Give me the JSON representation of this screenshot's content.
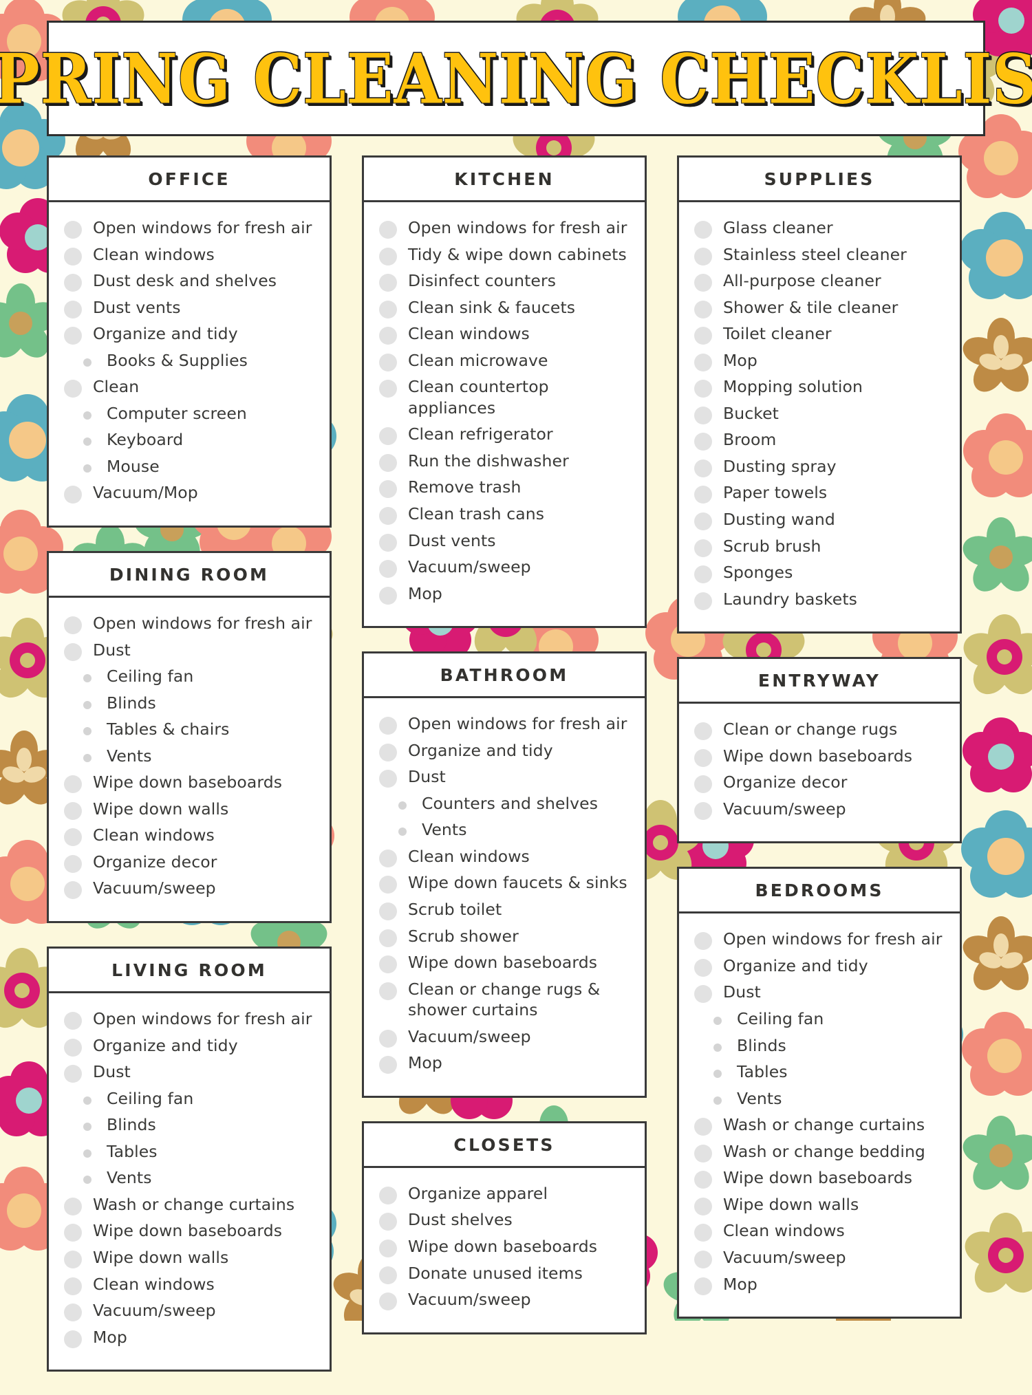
{
  "header": {
    "title": "SPRING CLEANING CHECKLIST"
  },
  "theme": {
    "accent_yellow": "#FFC20E",
    "ink": "#3a3a38",
    "card_bg": "#FFFFFF",
    "page_bg": "#FCF8DC",
    "bullet": "#E2E2E2",
    "sub_bullet": "#D4D4D4",
    "floral_coral": "#F28C7B",
    "floral_teal": "#5BAFC0",
    "floral_peach": "#F5C888",
    "floral_magenta": "#D81B73",
    "floral_green": "#74C189",
    "floral_brown": "#BE8B45",
    "floral_olive": "#CFC273"
  },
  "columns": [
    {
      "cards": [
        {
          "title": "OFFICE",
          "items": [
            {
              "label": "Open windows for fresh air",
              "sub": false
            },
            {
              "label": "Clean windows",
              "sub": false
            },
            {
              "label": "Dust desk and shelves",
              "sub": false
            },
            {
              "label": "Dust vents",
              "sub": false
            },
            {
              "label": "Organize and tidy",
              "sub": false
            },
            {
              "label": "Books & Supplies",
              "sub": true
            },
            {
              "label": "Clean",
              "sub": false
            },
            {
              "label": "Computer screen",
              "sub": true
            },
            {
              "label": "Keyboard",
              "sub": true
            },
            {
              "label": "Mouse",
              "sub": true
            },
            {
              "label": "Vacuum/Mop",
              "sub": false
            }
          ]
        },
        {
          "title": "DINING ROOM",
          "items": [
            {
              "label": "Open windows for fresh air",
              "sub": false
            },
            {
              "label": "Dust",
              "sub": false
            },
            {
              "label": "Ceiling fan",
              "sub": true
            },
            {
              "label": "Blinds",
              "sub": true
            },
            {
              "label": "Tables & chairs",
              "sub": true
            },
            {
              "label": "Vents",
              "sub": true
            },
            {
              "label": "Wipe down baseboards",
              "sub": false
            },
            {
              "label": "Wipe down walls",
              "sub": false
            },
            {
              "label": "Clean windows",
              "sub": false
            },
            {
              "label": "Organize decor",
              "sub": false
            },
            {
              "label": "Vacuum/sweep",
              "sub": false
            }
          ]
        },
        {
          "title": "LIVING ROOM",
          "items": [
            {
              "label": "Open windows for fresh air",
              "sub": false
            },
            {
              "label": "Organize and tidy",
              "sub": false
            },
            {
              "label": "Dust",
              "sub": false
            },
            {
              "label": "Ceiling fan",
              "sub": true
            },
            {
              "label": "Blinds",
              "sub": true
            },
            {
              "label": "Tables",
              "sub": true
            },
            {
              "label": "Vents",
              "sub": true
            },
            {
              "label": "Wash or change curtains",
              "sub": false
            },
            {
              "label": "Wipe down baseboards",
              "sub": false
            },
            {
              "label": "Wipe down walls",
              "sub": false
            },
            {
              "label": "Clean windows",
              "sub": false
            },
            {
              "label": "Vacuum/sweep",
              "sub": false
            },
            {
              "label": "Mop",
              "sub": false
            }
          ]
        }
      ]
    },
    {
      "cards": [
        {
          "title": "KITCHEN",
          "items": [
            {
              "label": "Open windows for fresh air",
              "sub": false
            },
            {
              "label": "Tidy & wipe down cabinets",
              "sub": false
            },
            {
              "label": "Disinfect counters",
              "sub": false
            },
            {
              "label": "Clean sink & faucets",
              "sub": false
            },
            {
              "label": "Clean windows",
              "sub": false
            },
            {
              "label": "Clean microwave",
              "sub": false
            },
            {
              "label": "Clean countertop appliances",
              "sub": false
            },
            {
              "label": "Clean refrigerator",
              "sub": false
            },
            {
              "label": "Run the dishwasher",
              "sub": false
            },
            {
              "label": "Remove trash",
              "sub": false
            },
            {
              "label": "Clean trash cans",
              "sub": false
            },
            {
              "label": "Dust vents",
              "sub": false
            },
            {
              "label": "Vacuum/sweep",
              "sub": false
            },
            {
              "label": "Mop",
              "sub": false
            }
          ]
        },
        {
          "title": "BATHROOM",
          "items": [
            {
              "label": "Open windows for fresh air",
              "sub": false
            },
            {
              "label": "Organize and tidy",
              "sub": false
            },
            {
              "label": "Dust",
              "sub": false
            },
            {
              "label": "Counters and shelves",
              "sub": true
            },
            {
              "label": "Vents",
              "sub": true
            },
            {
              "label": "Clean windows",
              "sub": false
            },
            {
              "label": "Wipe down faucets & sinks",
              "sub": false
            },
            {
              "label": "Scrub toilet",
              "sub": false
            },
            {
              "label": "Scrub shower",
              "sub": false
            },
            {
              "label": "Wipe down baseboards",
              "sub": false
            },
            {
              "label": "Clean or change rugs & shower curtains",
              "sub": false
            },
            {
              "label": "Vacuum/sweep",
              "sub": false
            },
            {
              "label": "Mop",
              "sub": false
            }
          ]
        },
        {
          "title": "CLOSETS",
          "items": [
            {
              "label": "Organize apparel",
              "sub": false
            },
            {
              "label": "Dust shelves",
              "sub": false
            },
            {
              "label": "Wipe down baseboards",
              "sub": false
            },
            {
              "label": "Donate unused items",
              "sub": false
            },
            {
              "label": "Vacuum/sweep",
              "sub": false
            }
          ]
        }
      ]
    },
    {
      "cards": [
        {
          "title": "SUPPLIES",
          "items": [
            {
              "label": "Glass cleaner",
              "sub": false
            },
            {
              "label": "Stainless steel cleaner",
              "sub": false
            },
            {
              "label": "All-purpose cleaner",
              "sub": false
            },
            {
              "label": "Shower & tile cleaner",
              "sub": false
            },
            {
              "label": "Toilet cleaner",
              "sub": false
            },
            {
              "label": "Mop",
              "sub": false
            },
            {
              "label": "Mopping solution",
              "sub": false
            },
            {
              "label": "Bucket",
              "sub": false
            },
            {
              "label": "Broom",
              "sub": false
            },
            {
              "label": "Dusting spray",
              "sub": false
            },
            {
              "label": "Paper towels",
              "sub": false
            },
            {
              "label": "Dusting wand",
              "sub": false
            },
            {
              "label": "Scrub brush",
              "sub": false
            },
            {
              "label": "Sponges",
              "sub": false
            },
            {
              "label": "Laundry baskets",
              "sub": false
            }
          ]
        },
        {
          "title": "ENTRYWAY",
          "items": [
            {
              "label": "Clean or change rugs",
              "sub": false
            },
            {
              "label": "Wipe down baseboards",
              "sub": false
            },
            {
              "label": "Organize decor",
              "sub": false
            },
            {
              "label": "Vacuum/sweep",
              "sub": false
            }
          ]
        },
        {
          "title": "BEDROOMS",
          "items": [
            {
              "label": "Open windows for fresh air",
              "sub": false
            },
            {
              "label": "Organize and tidy",
              "sub": false
            },
            {
              "label": "Dust",
              "sub": false
            },
            {
              "label": "Ceiling fan",
              "sub": true
            },
            {
              "label": "Blinds",
              "sub": true
            },
            {
              "label": "Tables",
              "sub": true
            },
            {
              "label": "Vents",
              "sub": true
            },
            {
              "label": "Wash or change curtains",
              "sub": false
            },
            {
              "label": "Wash or change bedding",
              "sub": false
            },
            {
              "label": "Wipe down baseboards",
              "sub": false
            },
            {
              "label": "Wipe down walls",
              "sub": false
            },
            {
              "label": "Clean windows",
              "sub": false
            },
            {
              "label": "Vacuum/sweep",
              "sub": false
            },
            {
              "label": "Mop",
              "sub": false
            }
          ]
        }
      ]
    }
  ]
}
